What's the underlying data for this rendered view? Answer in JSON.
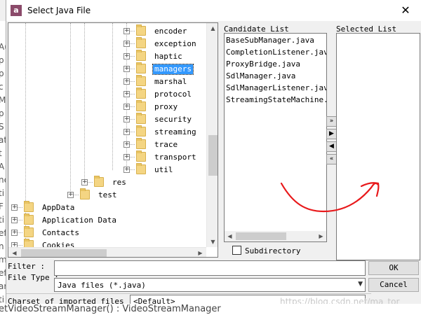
{
  "background": {
    "left_fragments": [
      "A(",
      "p",
      "p",
      "c",
      "M",
      "p",
      "S",
      "at",
      "t",
      "A",
      "ne",
      "ti",
      "F",
      "ti",
      "ef",
      "n",
      "m",
      "ef",
      "ar",
      "ti"
    ],
    "bottom_line": "etVideoStreamManager() : VideoStreamManager"
  },
  "window": {
    "title": "Select Java File",
    "app_icon_text": "a",
    "close_glyph": "✕"
  },
  "tree": {
    "items": [
      {
        "label": "encoder",
        "selected": false
      },
      {
        "label": "exception",
        "selected": false
      },
      {
        "label": "haptic",
        "selected": false
      },
      {
        "label": "managers",
        "selected": true
      },
      {
        "label": "marshal",
        "selected": false
      },
      {
        "label": "protocol",
        "selected": false
      },
      {
        "label": "proxy",
        "selected": false
      },
      {
        "label": "security",
        "selected": false
      },
      {
        "label": "streaming",
        "selected": false
      },
      {
        "label": "trace",
        "selected": false
      },
      {
        "label": "transport",
        "selected": false
      },
      {
        "label": "util",
        "selected": false
      },
      {
        "label": "res",
        "selected": false
      },
      {
        "label": "test",
        "selected": false
      },
      {
        "label": "AppData",
        "selected": false
      },
      {
        "label": "Application Data",
        "selected": false
      },
      {
        "label": "Contacts",
        "selected": false
      },
      {
        "label": "Cookies",
        "selected": false
      }
    ],
    "expander_glyph": "+"
  },
  "candidate": {
    "label": "Candidate List",
    "items": [
      "BaseSubManager.java",
      "CompletionListener.java",
      "ProxyBridge.java",
      "SdlManager.java",
      "SdlManagerListener.java",
      "StreamingStateMachine.java"
    ]
  },
  "transfer": {
    "add_all": "»",
    "add": "▶",
    "remove": "◀",
    "remove_all": "«"
  },
  "selected_list": {
    "label": "Selected List"
  },
  "subdirectory": {
    "label": "Subdirectory",
    "checked": false
  },
  "form": {
    "filter_label": "Filter :",
    "filter_value": "",
    "filetype_label": "File Type :",
    "filetype_value": "Java files (*.java)",
    "charset_label": "Charset of imported files",
    "charset_value": "<Default>",
    "ok_label": "OK",
    "cancel_label": "Cancel"
  },
  "watermark": "https://blog.csdn.net/ma_tor",
  "colors": {
    "selection": "#3399ff",
    "annotation": "#e8191b",
    "folder": "#f4d583"
  }
}
